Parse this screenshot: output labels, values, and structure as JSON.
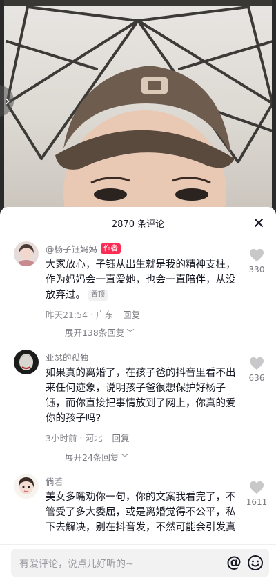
{
  "video": {
    "prev_arrow": "›"
  },
  "comments_panel": {
    "title": "2870 条评论",
    "close_icon": "close-icon"
  },
  "comments": [
    {
      "user": "@杨子钰妈妈",
      "badge": "作者",
      "text": "大家放心，子钰从出生就是我的精神支柱，作为妈妈会一直爱她，也会一直陪伴，从没放弃过。",
      "pinned": "置顶",
      "time": "昨天21:54",
      "location": "广东",
      "reply_label": "回复",
      "expand": "展开138条回复",
      "likes": "330"
    },
    {
      "user": "亚瑟的孤独",
      "text": "如果真的离婚了，在孩子爸的抖音里看不出来任何迹象，说明孩子爸很想保护好杨子钰，而你直接把事情放到了网上，你真的爱你的孩子吗?",
      "time": "3小时前",
      "location": "河北",
      "reply_label": "回复",
      "expand": "展开24条回复",
      "likes": "636"
    },
    {
      "user": "倘若",
      "text": "美女多嘴劝你一句，你的文案我看完了，不管受了多大委屈，或是离婚觉得不公平，私下去解决，别在抖音发，不然可能会引发真正的网暴，毕竟你们发生过什么谁也不知",
      "likes": "1611"
    }
  ],
  "input": {
    "placeholder": "有爱评论，说点儿好听的~",
    "at_symbol": "@"
  }
}
